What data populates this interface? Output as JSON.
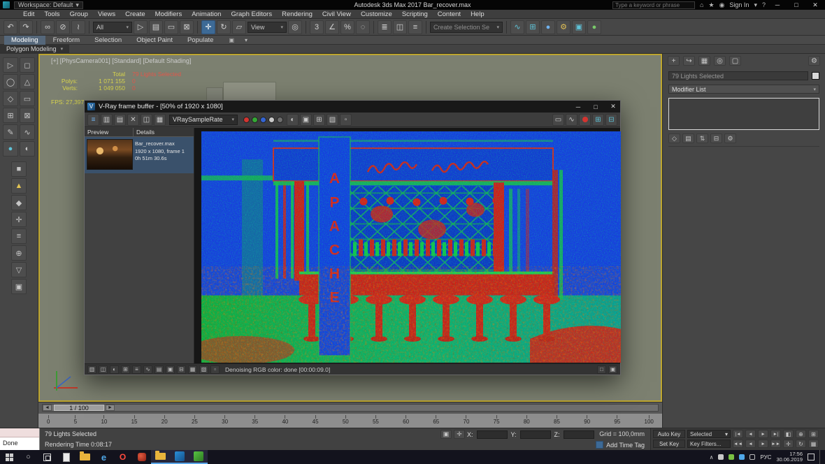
{
  "titlebar": {
    "workspace": "Workspace: Default",
    "title": "Autodesk 3ds Max 2017   Bar_recover.max",
    "search_placeholder": "Type a keyword or phrase",
    "signin": "Sign In"
  },
  "menubar": {
    "items": [
      "Edit",
      "Tools",
      "Group",
      "Views",
      "Create",
      "Modifiers",
      "Animation",
      "Graph Editors",
      "Rendering",
      "Civil View",
      "Customize",
      "Scripting",
      "Content",
      "Help"
    ]
  },
  "toolbar": {
    "filter": "All",
    "coord": "View",
    "named_sel": "Create Selection Se"
  },
  "ribbon": {
    "tabs": [
      "Modeling",
      "Freeform",
      "Selection",
      "Object Paint",
      "Populate"
    ],
    "panel": "Polygon Modeling"
  },
  "viewport": {
    "label": "[+]  [PhysCamera001]  [Standard]  [Default Shading]",
    "total_label": "Total",
    "selected": "79 Lights Selected",
    "polys_label": "Polys:",
    "polys_value": "1 071 155",
    "polys_sel": "0",
    "verts_label": "Verts:",
    "verts_value": "1 049 050",
    "verts_sel": "0",
    "fps": "FPS:  27,397"
  },
  "timeline": {
    "slider": "1 / 100",
    "ticks": [
      "0",
      "5",
      "10",
      "15",
      "20",
      "25",
      "30",
      "35",
      "40",
      "45",
      "50",
      "55",
      "60",
      "65",
      "70",
      "75",
      "80",
      "85",
      "90",
      "95",
      "100"
    ]
  },
  "vfb": {
    "title": "V-Ray frame buffer - [50% of 1920 x 1080]",
    "channel": "VRaySampleRate",
    "history_preview": "Preview",
    "history_details": "Details",
    "entry_line1": "Bar_recover.max",
    "entry_line2": "1920 x 1080, frame 1",
    "entry_line3": "0h 51m 30.6s",
    "status": "Denoising RGB color: done [00:00:09.0]",
    "sign": {
      "l0": "A",
      "l1": "P",
      "l2": "A",
      "l3": "C",
      "l4": "H",
      "l5": "E"
    }
  },
  "command_panel": {
    "selected": "79 Lights Selected",
    "modifier_list": "Modifier List"
  },
  "statusbar": {
    "listener": "Done",
    "prompt": "79 Lights Selected",
    "render_time": "Rendering Time 0:08:17",
    "x": "X:",
    "y": "Y:",
    "z": "Z:",
    "grid": "Grid = 100,0mm",
    "add_time_tag": "Add Time Tag",
    "auto_key": "Auto Key",
    "set_key": "Set Key",
    "sel_set": "Selected",
    "key_filters": "Key Filters..."
  },
  "taskbar": {
    "lang": "РУС",
    "time": "17:56",
    "date": "30.06.2019"
  },
  "icons": {
    "undo": "↶",
    "redo": "↷",
    "link": "∞",
    "unlink": "⊘",
    "bind": "≀",
    "select": "▷",
    "select_by_name": "▤",
    "region": "▭",
    "crossing": "⊠",
    "move": "✛",
    "rotate": "↻",
    "scale": "▱",
    "pivot": "◎",
    "snap3": "3",
    "snap_angle": "∠",
    "snap_percent": "%",
    "snap_spinner": "◌",
    "mirror": "◫",
    "align": "≡",
    "layers": "≣",
    "curve_editor": "∿",
    "schematic": "⊞",
    "material": "●",
    "render_setup": "⚙",
    "render_frame": "▣",
    "render": "●",
    "dropdown": "▼",
    "dropdown_small": "▾",
    "help": "?",
    "min": "─",
    "max": "□",
    "close": "✕",
    "home": "⌂",
    "star": "★",
    "user": "◉",
    "search": "○",
    "create": "+",
    "modify": "↪",
    "hierarchy": "▦",
    "motion": "◎",
    "display": "▢",
    "utilities": "⚙",
    "pin": "◇",
    "showend": "▤",
    "unique": "⇅",
    "remove": "⊟",
    "config": "⚙",
    "lock": "▣",
    "absmode": "✛",
    "goto_start": "|◄",
    "prev": "◄",
    "play": "►",
    "next": "►",
    "goto_end": "►|",
    "prev_key": "◄◄",
    "next_key": "►►",
    "zoom": "⊕",
    "pan": "✛",
    "orbit": "↻",
    "maxtoggle": "⊞",
    "extents": "◧",
    "region_zoom": "▦",
    "chevron_up": "∧",
    "vray": "V",
    "b1": "▫",
    "b2": "◫",
    "b3": "⊞",
    "b4": "≡",
    "b5": "∿",
    "b6": "▤",
    "b7": "◐",
    "b8": "▣",
    "b9": "⊟",
    "b10": "▦",
    "b11": "▥",
    "b12": "▧"
  },
  "left_tools": [
    "▷",
    "◻",
    "◯",
    "△",
    "◇",
    "▭",
    "⊞",
    "⊠",
    "✎",
    "∿",
    "●",
    "◐",
    "■",
    "▲",
    "◆",
    "✛",
    "≡",
    "⊕",
    "▽",
    "▣"
  ]
}
